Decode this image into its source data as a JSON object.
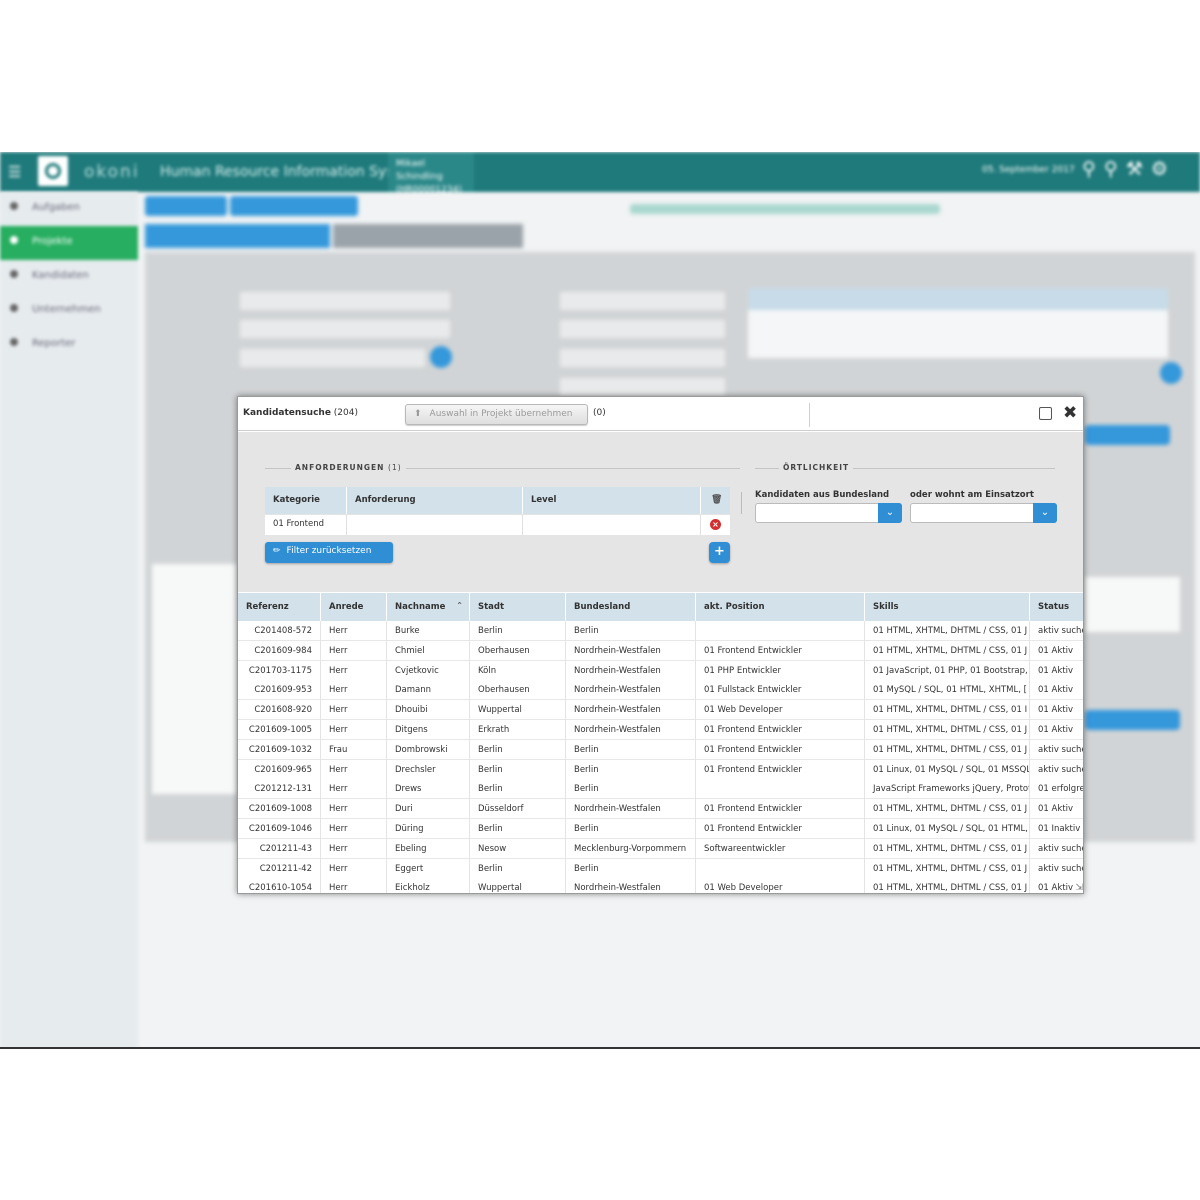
{
  "app": {
    "brand": "okoni",
    "title": "Human Resource Information System",
    "user_line1": "Mikael Schindling",
    "user_line2": "(HR00001234)",
    "date": "05. September 2017"
  },
  "sidebar": {
    "items": [
      {
        "label": "Aufgaben"
      },
      {
        "label": "Projekte"
      },
      {
        "label": "Kandidaten"
      },
      {
        "label": "Unternehmen"
      },
      {
        "label": "Reporter"
      }
    ]
  },
  "modal": {
    "title": "Kandidatensuche",
    "count": "(204)",
    "add_button": "Auswahl in Projekt übernehmen",
    "selected_count": "(0)",
    "filter": {
      "requirements_label": "ANFORDERUNGEN",
      "requirements_count": "(1)",
      "location_label": "ÖRTLICHKEIT",
      "columns": [
        "Kategorie",
        "Anforderung",
        "Level"
      ],
      "rows": [
        {
          "kategorie": "01 Frontend",
          "anforderung": "",
          "level": ""
        }
      ],
      "reset_button": "Filter zurücksetzen",
      "state_label": "Kandidaten aus Bundesland",
      "city_label": "oder wohnt am Einsatzort"
    },
    "grid": {
      "columns": [
        "Referenz",
        "Anrede",
        "Nachname",
        "Stadt",
        "Bundesland",
        "akt. Position",
        "Skills",
        "Status"
      ],
      "rows": [
        {
          "ref": "C201408-572",
          "anrede": "Herr",
          "name": "Burke",
          "stadt": "Berlin",
          "land": "Berlin",
          "pos": "",
          "skills": "01 HTML, XHTML, DHTML / CSS, 01 J",
          "status": "aktiv suche"
        },
        {
          "ref": "C201609-984",
          "anrede": "Herr",
          "name": "Chmiel",
          "stadt": "Oberhausen",
          "land": "Nordrhein-Westfalen",
          "pos": "01 Frontend Entwickler",
          "skills": "01 HTML, XHTML, DHTML / CSS, 01 J",
          "status": "01 Aktiv"
        },
        {
          "ref": "C201703-1175",
          "anrede": "Herr",
          "name": "Cvjetkovic",
          "stadt": "Köln",
          "land": "Nordrhein-Westfalen",
          "pos": "01 PHP Entwickler",
          "skills": "01 JavaScript, 01 PHP, 01 Bootstrap, (",
          "status": "01 Aktiv"
        },
        {
          "ref": "C201609-953",
          "anrede": "Herr",
          "name": "Damann",
          "stadt": "Oberhausen",
          "land": "Nordrhein-Westfalen",
          "pos": "01 Fullstack Entwickler",
          "skills": "01 MySQL / SQL, 01 HTML, XHTML, [",
          "status": "01 Aktiv"
        },
        {
          "ref": "C201608-920",
          "anrede": "Herr",
          "name": "Dhouibi",
          "stadt": "Wuppertal",
          "land": "Nordrhein-Westfalen",
          "pos": "01 Web Developer",
          "skills": "01 HTML, XHTML, DHTML / CSS, 01 I",
          "status": "01 Aktiv"
        },
        {
          "ref": "C201609-1005",
          "anrede": "Herr",
          "name": "Ditgens ",
          "stadt": "Erkrath ",
          "land": "Nordrhein-Westfalen",
          "pos": "01 Frontend Entwickler",
          "skills": "01 HTML, XHTML, DHTML / CSS, 01 J",
          "status": "01 Aktiv"
        },
        {
          "ref": "C201609-1032",
          "anrede": "Frau",
          "name": "Dombrowski",
          "stadt": "Berlin",
          "land": "Berlin",
          "pos": "01 Frontend Entwickler",
          "skills": "01 HTML, XHTML, DHTML / CSS, 01 J",
          "status": "aktiv suche"
        },
        {
          "ref": "C201609-965",
          "anrede": "Herr",
          "name": "Drechsler",
          "stadt": "Berlin",
          "land": "Berlin",
          "pos": "01 Frontend Entwickler",
          "skills": "01 Linux, 01 MySQL / SQL, 01 MSSQL",
          "status": "aktiv suche"
        },
        {
          "ref": "C201212-131",
          "anrede": "Herr",
          "name": "Drews",
          "stadt": "Berlin",
          "land": "Berlin",
          "pos": "",
          "skills": "JavaScript Frameworks jQuery, Protot",
          "status": "01 erfolgre"
        },
        {
          "ref": "C201609-1008",
          "anrede": "Herr",
          "name": "Duri",
          "stadt": "Düsseldorf",
          "land": "Nordrhein-Westfalen",
          "pos": "01 Frontend Entwickler",
          "skills": "01 HTML, XHTML, DHTML / CSS, 01 J",
          "status": "01 Aktiv"
        },
        {
          "ref": "C201609-1046",
          "anrede": "Herr",
          "name": "Düring",
          "stadt": "Berlin",
          "land": "Berlin",
          "pos": "01 Frontend Entwickler",
          "skills": "01 Linux, 01 MySQL / SQL, 01 HTML,",
          "status": "01 Inaktiv"
        },
        {
          "ref": "C201211-43",
          "anrede": "Herr",
          "name": "Ebeling",
          "stadt": "Nesow",
          "land": "Mecklenburg-Vorpommern",
          "pos": "Softwareentwickler",
          "skills": "01 HTML, XHTML, DHTML / CSS, 01 J",
          "status": "aktiv suche"
        },
        {
          "ref": "C201211-42",
          "anrede": "Herr",
          "name": "Eggert",
          "stadt": "Berlin",
          "land": "Berlin",
          "pos": "",
          "skills": "01 HTML, XHTML, DHTML / CSS, 01 J",
          "status": "aktiv suche"
        },
        {
          "ref": "C201610-1054",
          "anrede": "Herr",
          "name": "Eickholz",
          "stadt": "Wuppertal",
          "land": "Nordrhein-Westfalen",
          "pos": "01 Web Developer",
          "skills": "01 HTML, XHTML, DHTML / CSS, 01 J",
          "status": "01 Aktiv"
        }
      ]
    }
  },
  "colors": {
    "header": "#1f7a7b",
    "active_nav": "#27ae60",
    "primary_button": "#2f8ed4",
    "grid_header": "#d3e1ea",
    "delete": "#d32f2f"
  },
  "icons": [
    "menu-icon",
    "logo-icon",
    "zoom-icon",
    "wrench-icon",
    "settings-icon",
    "upload-icon",
    "checkbox-icon",
    "close-icon",
    "trash-icon",
    "remove-icon",
    "eraser-icon",
    "plus-icon",
    "chevron-down-icon",
    "sort-asc-icon",
    "resize-handle-icon"
  ]
}
